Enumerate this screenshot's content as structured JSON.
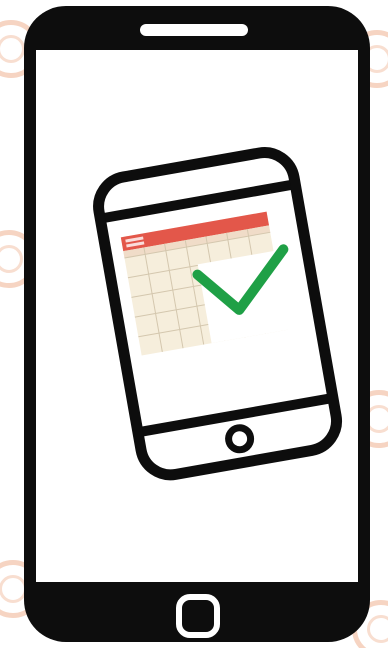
{
  "illustration": {
    "outer_device": {
      "name": "smartphone",
      "frame_color": "#0d0d0d",
      "screen_color": "#ffffff"
    },
    "inner_device": {
      "name": "tilted-smartphone",
      "frame_color": "#0d0d0d",
      "screen_color": "#ffffff"
    },
    "calendar": {
      "header_color": "#e3574a",
      "grid_color": "#f6eedc",
      "line_color": "#d4c7ae",
      "columns": 7,
      "rows": 5
    },
    "checkmark": {
      "name": "check-icon",
      "color": "#1fa046"
    },
    "watermark": {
      "color": "#ec9f78"
    }
  }
}
